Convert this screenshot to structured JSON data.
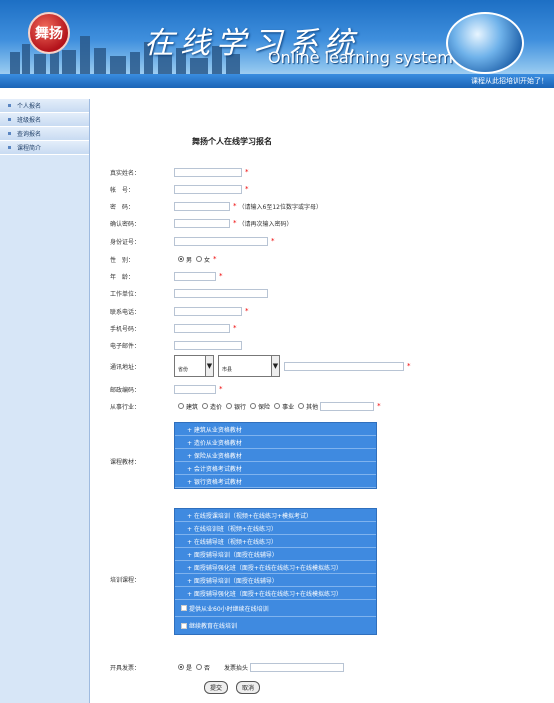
{
  "header": {
    "logo_text": "舞扬",
    "title_cn": "在线学习系统",
    "title_en": "Online learning system",
    "marquee": "课程从此招培训开始了！",
    "brand_color": "#1d6fc4"
  },
  "sidebar": {
    "items": [
      {
        "label": "个人报名"
      },
      {
        "label": "班级报名"
      },
      {
        "label": "查询报名"
      },
      {
        "label": "课程简介"
      }
    ]
  },
  "form": {
    "title": "舞扬个人在线学习报名",
    "fields": {
      "realname": "真实姓名：",
      "account": "帐　号：",
      "password": "密　码：",
      "password_note": "（请输入6至12位数字或字母）",
      "confirm": "确认密码：",
      "confirm_note": "（请再次输入密码）",
      "idcard": "身份证号：",
      "gender": "性　别：",
      "male": "男",
      "female": "女",
      "age": "年　龄：",
      "work": "工作单位：",
      "phone": "联系电话：",
      "mobile": "手机号码：",
      "email": "电子邮件：",
      "address": "通讯地址：",
      "select1": "省份",
      "select2": "市县",
      "postcode": "邮政编码：",
      "industry": "从事行业：",
      "industry_options": [
        "建筑",
        "造价",
        "银行",
        "保险",
        "事业",
        "其他"
      ],
      "materials": "课程教材：",
      "training": "培训课程：",
      "invoice": "开具发票：",
      "yes": "是",
      "no": "否",
      "invoice_title": "发票抬头",
      "submit": "提交",
      "reset": "取消"
    },
    "materials_options": [
      "+ 建筑从业资格教材",
      "+ 造价从业资格教材",
      "+ 保险从业资格教材",
      "+ 会计资格考试教材",
      "+ 银行资格考试教材"
    ],
    "training_options": [
      "+ 在线授课培训（视频+在线练习+模拟考试）",
      "+ 在线培训班（视频+在线练习）",
      "+ 在线辅导班（视频+在线练习）",
      "+ 面授辅导培训（面授在线辅导）",
      "+ 面授辅导强化班（面授+在线在线练习+在线模拟练习）",
      "+ 面授辅导培训（面授在线辅导）",
      "+ 面授辅导强化班（面授+在线在线练习+在线模拟练习）"
    ],
    "training_checks": [
      "提供从业60小时继续在线培训",
      "继续教育在线培训"
    ]
  }
}
